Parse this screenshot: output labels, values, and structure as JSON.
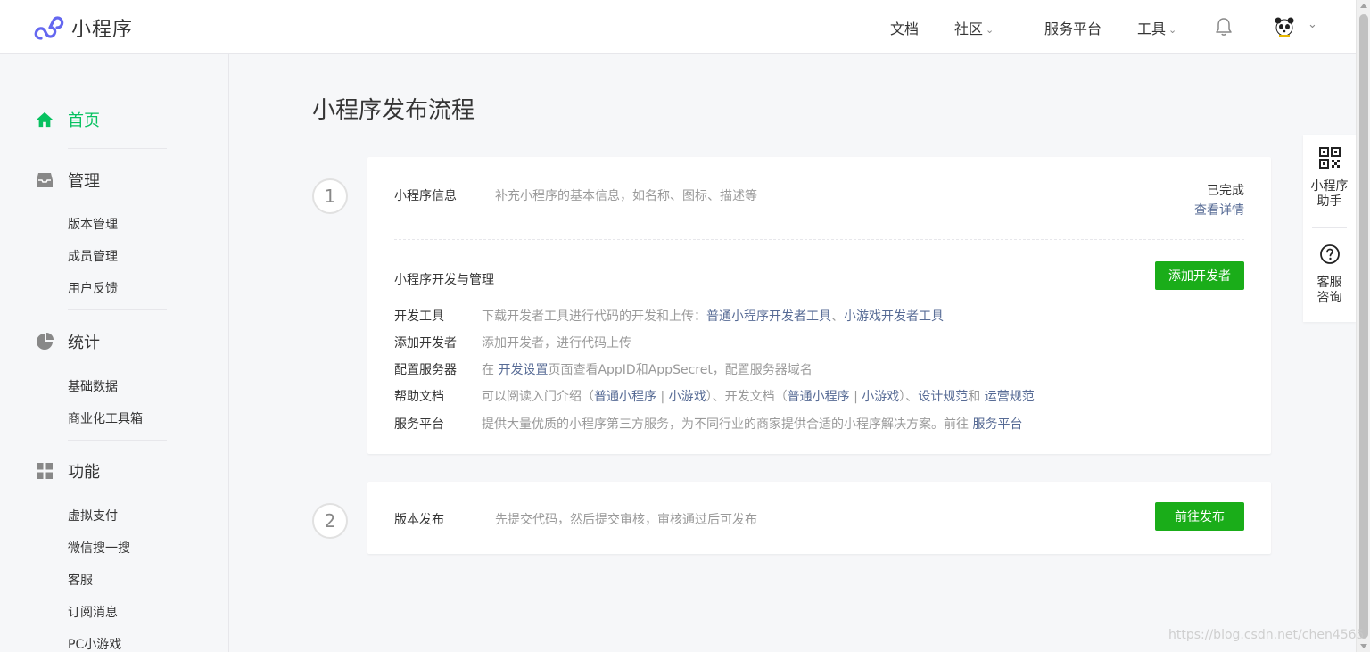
{
  "header": {
    "brand": "小程序",
    "nav": {
      "docs": "文档",
      "community": "社区",
      "service_platform": "服务平台",
      "tools": "工具"
    }
  },
  "sidebar": {
    "home": "首页",
    "manage": {
      "title": "管理",
      "items": [
        "版本管理",
        "成员管理",
        "用户反馈"
      ]
    },
    "stats": {
      "title": "统计",
      "items": [
        "基础数据",
        "商业化工具箱"
      ]
    },
    "features": {
      "title": "功能",
      "items": [
        "虚拟支付",
        "微信搜一搜",
        "客服",
        "订阅消息",
        "PC小游戏"
      ]
    }
  },
  "main": {
    "title": "小程序发布流程",
    "step1": {
      "number": "1",
      "info_title": "小程序信息",
      "info_desc": "补充小程序的基本信息，如名称、图标、描述等",
      "status": "已完成",
      "detail_link": "查看详情",
      "dev_title": "小程序开发与管理",
      "add_dev_button": "添加开发者",
      "rows": {
        "devtools": {
          "label": "开发工具",
          "text": "下载开发者工具进行代码的开发和上传：",
          "link1": "普通小程序开发者工具",
          "sep": "、",
          "link2": "小游戏开发者工具"
        },
        "add_dev": {
          "label": "添加开发者",
          "text": "添加开发者，进行代码上传"
        },
        "server": {
          "label": "配置服务器",
          "pre": "在 ",
          "link": "开发设置",
          "post": "页面查看AppID和AppSecret，配置服务器域名"
        },
        "help": {
          "label": "帮助文档",
          "t1": "可以阅读入门介绍（",
          "l1": "普通小程序",
          "pipe": " | ",
          "l2": "小游戏",
          "t2": "）、开发文档（",
          "l3": "普通小程序",
          "l4": "小游戏",
          "t3": "）、",
          "l5": "设计规范",
          "and": "和 ",
          "l6": "运营规范"
        },
        "platform": {
          "label": "服务平台",
          "text": "提供大量优质的小程序第三方服务，为不同行业的商家提供合适的小程序解决方案。前往 ",
          "link": "服务平台"
        }
      }
    },
    "step2": {
      "number": "2",
      "title": "版本发布",
      "desc": "先提交代码，然后提交审核，审核通过后可发布",
      "button": "前往发布"
    }
  },
  "float_panel": {
    "assistant": "小程序助手",
    "support": "客服咨询"
  },
  "watermark": "https://blog.csdn.net/chen4565",
  "colors": {
    "accent_green": "#07c160",
    "button_green": "#1aad19",
    "link_blue": "#576b95",
    "logo_purple": "#6467f0"
  }
}
